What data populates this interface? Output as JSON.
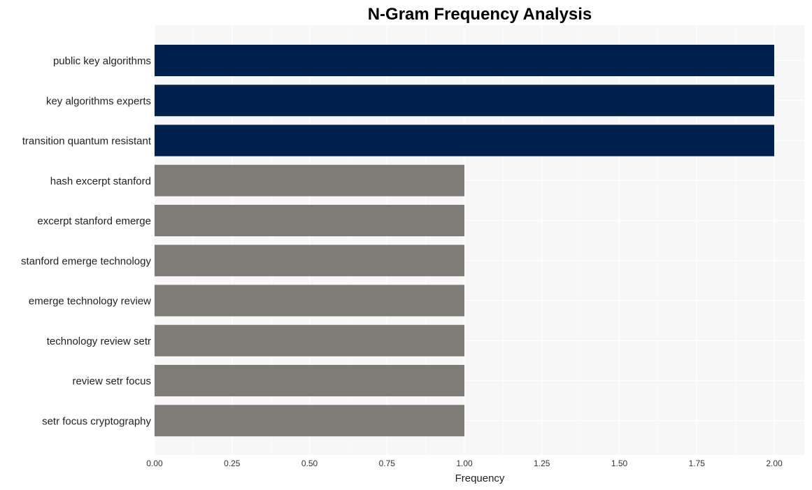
{
  "chart_data": {
    "type": "bar",
    "orientation": "horizontal",
    "title": "N-Gram Frequency Analysis",
    "xlabel": "Frequency",
    "ylabel": "",
    "xlim": [
      0,
      2.1
    ],
    "xticks": [
      "0.00",
      "0.25",
      "0.50",
      "0.75",
      "1.00",
      "1.25",
      "1.50",
      "1.75",
      "2.00"
    ],
    "grid": true,
    "categories": [
      "public key algorithms",
      "key algorithms experts",
      "transition quantum resistant",
      "hash excerpt stanford",
      "excerpt stanford emerge",
      "stanford emerge technology",
      "emerge technology review",
      "technology review setr",
      "review setr focus",
      "setr focus cryptography"
    ],
    "values": [
      2,
      2,
      2,
      1,
      1,
      1,
      1,
      1,
      1,
      1
    ],
    "colors": {
      "highlight": "#00214d",
      "default": "#7f7c78",
      "plot_background": "#f7f7f7",
      "grid": "#ffffff"
    }
  }
}
